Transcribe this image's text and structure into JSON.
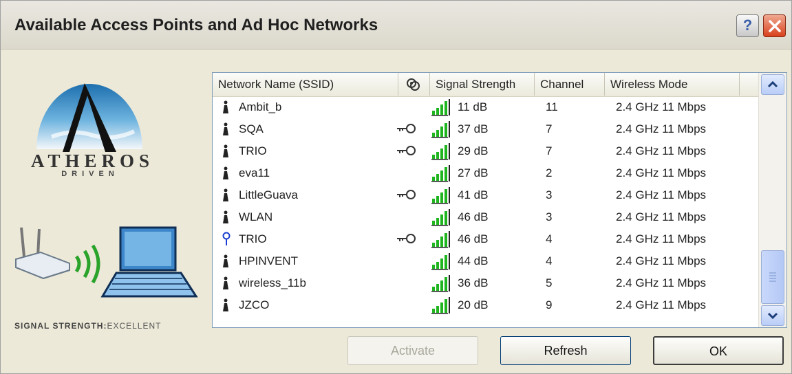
{
  "window": {
    "title": "Available Access Points and Ad Hoc Networks"
  },
  "brand": {
    "name": "ATHEROS",
    "tagline": "DRIVEN"
  },
  "status": {
    "label": "SIGNAL STRENGTH:",
    "value": "EXCELLENT"
  },
  "columns": {
    "ssid": "Network Name (SSID)",
    "security": "",
    "signal": "Signal Strength",
    "channel": "Channel",
    "mode": "Wireless Mode"
  },
  "networks": [
    {
      "type": "access-point",
      "ssid": "Ambit_b",
      "secured": false,
      "signal": "11 dB",
      "channel": "11",
      "mode": "2.4 GHz 11 Mbps"
    },
    {
      "type": "access-point",
      "ssid": "SQA",
      "secured": true,
      "signal": "37 dB",
      "channel": "7",
      "mode": "2.4 GHz 11 Mbps"
    },
    {
      "type": "access-point",
      "ssid": "TRIO",
      "secured": true,
      "signal": "29 dB",
      "channel": "7",
      "mode": "2.4 GHz 11 Mbps"
    },
    {
      "type": "access-point",
      "ssid": "eva11",
      "secured": false,
      "signal": "27 dB",
      "channel": "2",
      "mode": "2.4 GHz 11 Mbps"
    },
    {
      "type": "access-point",
      "ssid": "LittleGuava",
      "secured": true,
      "signal": "41 dB",
      "channel": "3",
      "mode": "2.4 GHz 11 Mbps"
    },
    {
      "type": "access-point",
      "ssid": "WLAN",
      "secured": false,
      "signal": "46 dB",
      "channel": "3",
      "mode": "2.4 GHz 11 Mbps"
    },
    {
      "type": "ad-hoc",
      "ssid": "TRIO",
      "secured": true,
      "signal": "46 dB",
      "channel": "4",
      "mode": "2.4 GHz 11 Mbps"
    },
    {
      "type": "access-point",
      "ssid": "HPINVENT",
      "secured": false,
      "signal": "44 dB",
      "channel": "4",
      "mode": "2.4 GHz 11 Mbps"
    },
    {
      "type": "access-point",
      "ssid": "wireless_11b",
      "secured": false,
      "signal": "36 dB",
      "channel": "5",
      "mode": "2.4 GHz 11 Mbps"
    },
    {
      "type": "access-point",
      "ssid": "JZCO",
      "secured": false,
      "signal": "20 dB",
      "channel": "9",
      "mode": "2.4 GHz 11 Mbps"
    }
  ],
  "buttons": {
    "activate": "Activate",
    "refresh": "Refresh",
    "ok": "OK"
  },
  "colors": {
    "signal_bar": "#1fb51f",
    "accent": "#0a4fa8",
    "close": "#d8401c"
  }
}
